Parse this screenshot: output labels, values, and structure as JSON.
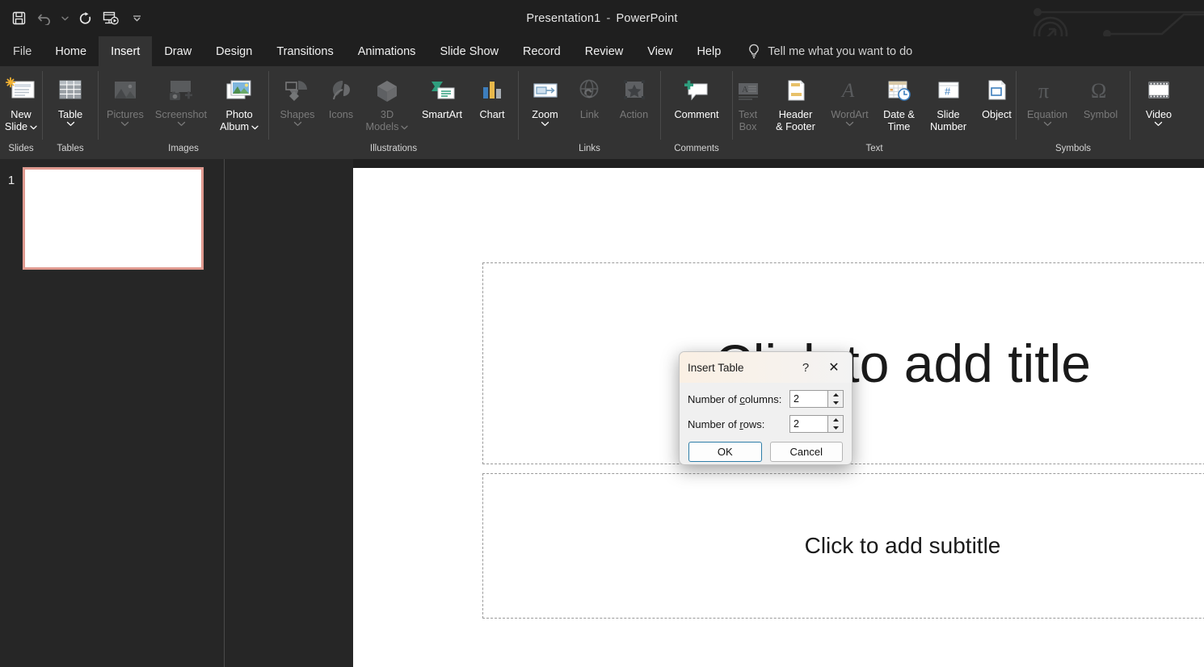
{
  "titlebar": {
    "document_name": "Presentation1",
    "separator": "-",
    "app_name": "PowerPoint",
    "quick_access": [
      {
        "name": "save",
        "icon": "save-icon",
        "enabled": true
      },
      {
        "name": "undo",
        "icon": "undo-icon",
        "enabled": false
      },
      {
        "name": "undo-dropdown",
        "icon": "chevron-down-icon",
        "enabled": false
      },
      {
        "name": "redo",
        "icon": "redo-icon",
        "enabled": true
      },
      {
        "name": "start-presentation",
        "icon": "present-icon",
        "enabled": true
      },
      {
        "name": "customize-quick-access-toolbar",
        "icon": "chevron-down-small-icon",
        "enabled": true
      }
    ]
  },
  "tabs": [
    {
      "label": "File",
      "active": false,
      "kind": "file"
    },
    {
      "label": "Home",
      "active": false
    },
    {
      "label": "Insert",
      "active": true
    },
    {
      "label": "Draw",
      "active": false
    },
    {
      "label": "Design",
      "active": false
    },
    {
      "label": "Transitions",
      "active": false
    },
    {
      "label": "Animations",
      "active": false
    },
    {
      "label": "Slide Show",
      "active": false
    },
    {
      "label": "Record",
      "active": false
    },
    {
      "label": "Review",
      "active": false
    },
    {
      "label": "View",
      "active": false
    },
    {
      "label": "Help",
      "active": false
    }
  ],
  "tell_me": {
    "label": "Tell me what you want to do",
    "icon": "lightbulb-icon"
  },
  "ribbon": {
    "groups": [
      {
        "label": "Slides",
        "items": [
          {
            "label_lines": [
              "New",
              "Slide"
            ],
            "icon": "new-slide-icon",
            "enabled": true,
            "dropdown": "inline"
          }
        ]
      },
      {
        "label": "Tables",
        "items": [
          {
            "label_lines": [
              "Table"
            ],
            "icon": "table-icon",
            "enabled": true,
            "dropdown": "below"
          }
        ]
      },
      {
        "label": "Images",
        "items": [
          {
            "label_lines": [
              "Pictures"
            ],
            "icon": "pictures-icon",
            "enabled": false,
            "dropdown": "below"
          },
          {
            "label_lines": [
              "Screenshot"
            ],
            "icon": "screenshot-icon",
            "enabled": false,
            "dropdown": "below"
          },
          {
            "label_lines": [
              "Photo",
              "Album"
            ],
            "icon": "photo-album-icon",
            "enabled": true,
            "dropdown": "inline"
          }
        ]
      },
      {
        "label": "Illustrations",
        "items": [
          {
            "label_lines": [
              "Shapes"
            ],
            "icon": "shapes-icon",
            "enabled": false,
            "dropdown": "below"
          },
          {
            "label_lines": [
              "Icons"
            ],
            "icon": "icons-icon",
            "enabled": false
          },
          {
            "label_lines": [
              "3D",
              "Models"
            ],
            "icon": "3d-models-icon",
            "enabled": false,
            "dropdown": "inline"
          },
          {
            "label_lines": [
              "SmartArt"
            ],
            "icon": "smartart-icon",
            "enabled": true
          },
          {
            "label_lines": [
              "Chart"
            ],
            "icon": "chart-icon",
            "enabled": true
          }
        ]
      },
      {
        "label": "Links",
        "items": [
          {
            "label_lines": [
              "Zoom"
            ],
            "icon": "zoom-icon",
            "enabled": true,
            "dropdown": "below"
          },
          {
            "label_lines": [
              "Link"
            ],
            "icon": "link-icon",
            "enabled": false
          },
          {
            "label_lines": [
              "Action"
            ],
            "icon": "action-icon",
            "enabled": false
          }
        ]
      },
      {
        "label": "Comments",
        "items": [
          {
            "label_lines": [
              "Comment"
            ],
            "icon": "comment-icon",
            "enabled": true
          }
        ]
      },
      {
        "label": "Text",
        "items": [
          {
            "label_lines": [
              "Text",
              "Box"
            ],
            "icon": "text-box-icon",
            "enabled": false
          },
          {
            "label_lines": [
              "Header",
              "& Footer"
            ],
            "icon": "header-footer-icon",
            "enabled": true
          },
          {
            "label_lines": [
              "WordArt"
            ],
            "icon": "wordart-icon",
            "enabled": false,
            "dropdown": "below"
          },
          {
            "label_lines": [
              "Date &",
              "Time"
            ],
            "icon": "date-time-icon",
            "enabled": true
          },
          {
            "label_lines": [
              "Slide",
              "Number"
            ],
            "icon": "slide-number-icon",
            "enabled": true
          },
          {
            "label_lines": [
              "Object"
            ],
            "icon": "object-icon",
            "enabled": true
          }
        ]
      },
      {
        "label": "Symbols",
        "items": [
          {
            "label_lines": [
              "Equation"
            ],
            "icon": "equation-icon",
            "enabled": false,
            "dropdown": "below"
          },
          {
            "label_lines": [
              "Symbol"
            ],
            "icon": "symbol-icon",
            "enabled": false
          }
        ]
      },
      {
        "label": "",
        "items": [
          {
            "label_lines": [
              "Video"
            ],
            "icon": "video-icon",
            "enabled": true,
            "dropdown": "below"
          }
        ]
      }
    ]
  },
  "slide_panel": {
    "slides": [
      {
        "number": "1",
        "selected": true
      }
    ],
    "selection_color": "#e09a90"
  },
  "slide": {
    "title_placeholder": "Click to add title",
    "subtitle_placeholder": "Click to add subtitle"
  },
  "dialog": {
    "title": "Insert Table",
    "help_label": "?",
    "close_label": "✕",
    "fields": [
      {
        "label_pre": "Number of ",
        "label_accel": "c",
        "label_post": "olumns:",
        "value": "2"
      },
      {
        "label_pre": "Number of ",
        "label_accel": "r",
        "label_post": "ows:",
        "value": "2"
      }
    ],
    "ok_label": "OK",
    "cancel_label": "Cancel"
  }
}
